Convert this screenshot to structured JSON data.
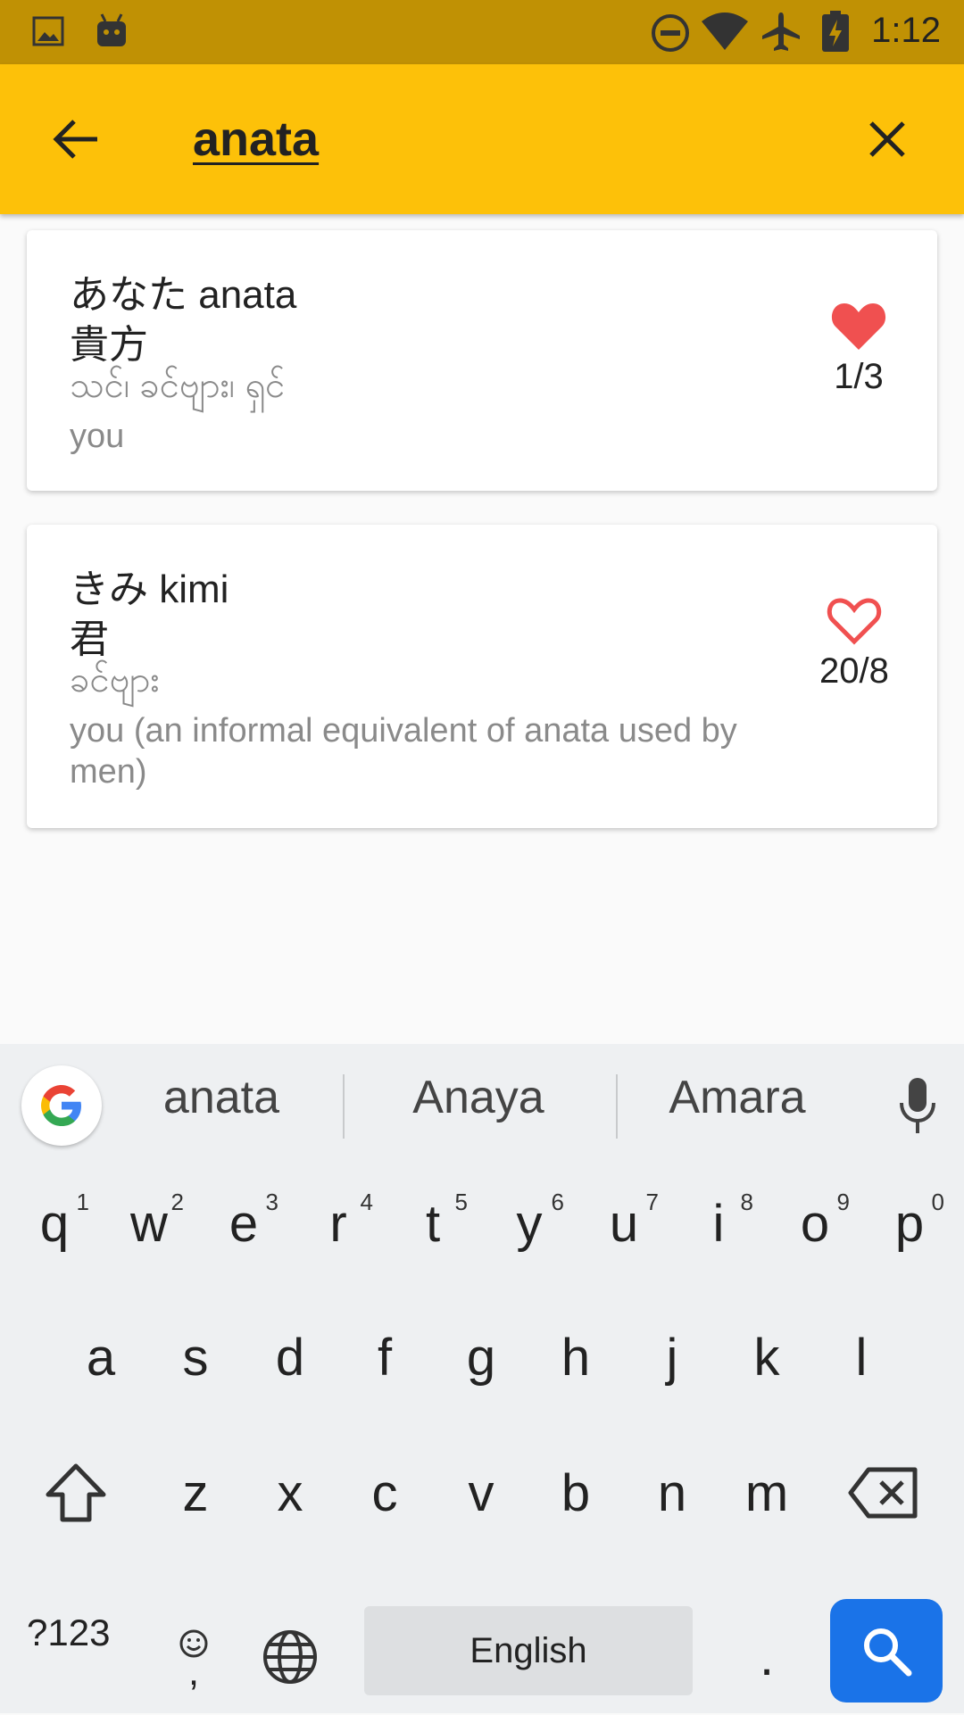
{
  "status_bar": {
    "time": "1:12",
    "icons": [
      "image-icon",
      "android-icon",
      "do-not-disturb-icon",
      "wifi-icon",
      "airplane-icon",
      "battery-charging-icon"
    ]
  },
  "app_bar": {
    "search_value": "anata",
    "back_icon": "arrow-left-icon",
    "clear_icon": "close-icon"
  },
  "results": [
    {
      "kana": "あなた anata",
      "kanji": "貴方",
      "myanmar": "သင်၊ ခင်ဗျား၊ ရှင်",
      "english": "you",
      "favorite": true,
      "count": "1/3"
    },
    {
      "kana": "きみ kimi",
      "kanji": "君",
      "myanmar": "ခင်ဗျား",
      "english": "you (an informal equivalent of anata used by men)",
      "favorite": false,
      "count": "20/8"
    }
  ],
  "keyboard": {
    "suggestions": [
      "anata",
      "Anaya",
      "Amara"
    ],
    "row1": [
      {
        "k": "q",
        "s": "1"
      },
      {
        "k": "w",
        "s": "2"
      },
      {
        "k": "e",
        "s": "3"
      },
      {
        "k": "r",
        "s": "4"
      },
      {
        "k": "t",
        "s": "5"
      },
      {
        "k": "y",
        "s": "6"
      },
      {
        "k": "u",
        "s": "7"
      },
      {
        "k": "i",
        "s": "8"
      },
      {
        "k": "o",
        "s": "9"
      },
      {
        "k": "p",
        "s": "0"
      }
    ],
    "row2": [
      "a",
      "s",
      "d",
      "f",
      "g",
      "h",
      "j",
      "k",
      "l"
    ],
    "row3": [
      "z",
      "x",
      "c",
      "v",
      "b",
      "n",
      "m"
    ],
    "symbols_label": "?123",
    "comma_label": ",",
    "space_label": "English",
    "period_label": ".",
    "accent_color": "#1a73e8"
  },
  "colors": {
    "status_bar": "#c09104",
    "app_bar": "#fdc109",
    "heart": "#f05050"
  }
}
